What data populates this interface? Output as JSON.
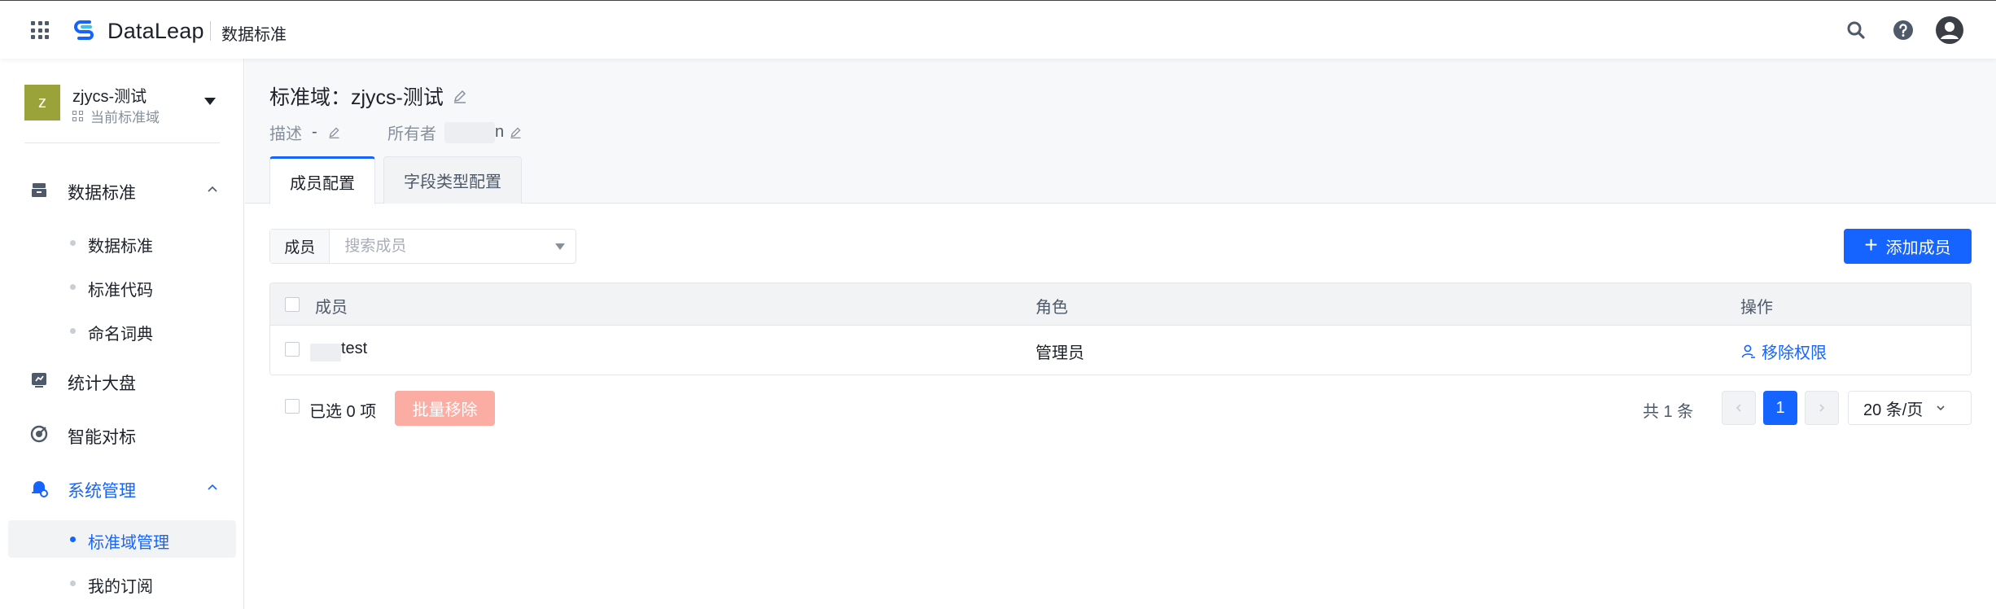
{
  "topbar": {
    "brand": "DataLeap",
    "product": "数据标准",
    "icons": [
      "apps-grid-icon",
      "dataleap-logo-icon",
      "search-icon",
      "help-icon",
      "user-icon"
    ]
  },
  "sidebar": {
    "domain": {
      "avatar_letter": "z",
      "avatar_color": "#9aa33a",
      "name": "zjycs-测试",
      "subtitle": "当前标准域"
    },
    "groups": [
      {
        "label": "数据标准",
        "icon": "archive-icon",
        "expanded": true,
        "items": [
          "数据标准",
          "标准代码",
          "命名词典"
        ]
      },
      {
        "label": "统计大盘",
        "icon": "dashboard-icon"
      },
      {
        "label": "智能对标",
        "icon": "target-icon"
      },
      {
        "label": "系统管理",
        "icon": "settings-bell-icon",
        "expanded": true,
        "active": true,
        "items": [
          "标准域管理",
          "我的订阅"
        ],
        "selected_item": "标准域管理"
      }
    ]
  },
  "header": {
    "title": "标准域：zjycs-测试",
    "description_label": "描述",
    "description_value": "-",
    "owner_label": "所有者",
    "owner_visible_tail": "n",
    "tabs": [
      "成员配置",
      "字段类型配置"
    ],
    "active_tab": "成员配置"
  },
  "filter": {
    "label": "成员",
    "placeholder": "搜索成员"
  },
  "add_member_button": "添加成员",
  "table": {
    "columns": [
      "成员",
      "角色",
      "操作"
    ],
    "rows": [
      {
        "member_visible": "test",
        "role": "管理员",
        "action": "移除权限"
      }
    ]
  },
  "footer": {
    "selected_text": "已选 0 项",
    "batch_remove": "批量移除",
    "total_text": "共 1 条",
    "current_page": "1",
    "page_size": "20 条/页"
  },
  "colors": {
    "primary": "#1664ff",
    "disabled_danger": "#fbaca3",
    "text": "#1d2129",
    "muted": "#86909c"
  }
}
